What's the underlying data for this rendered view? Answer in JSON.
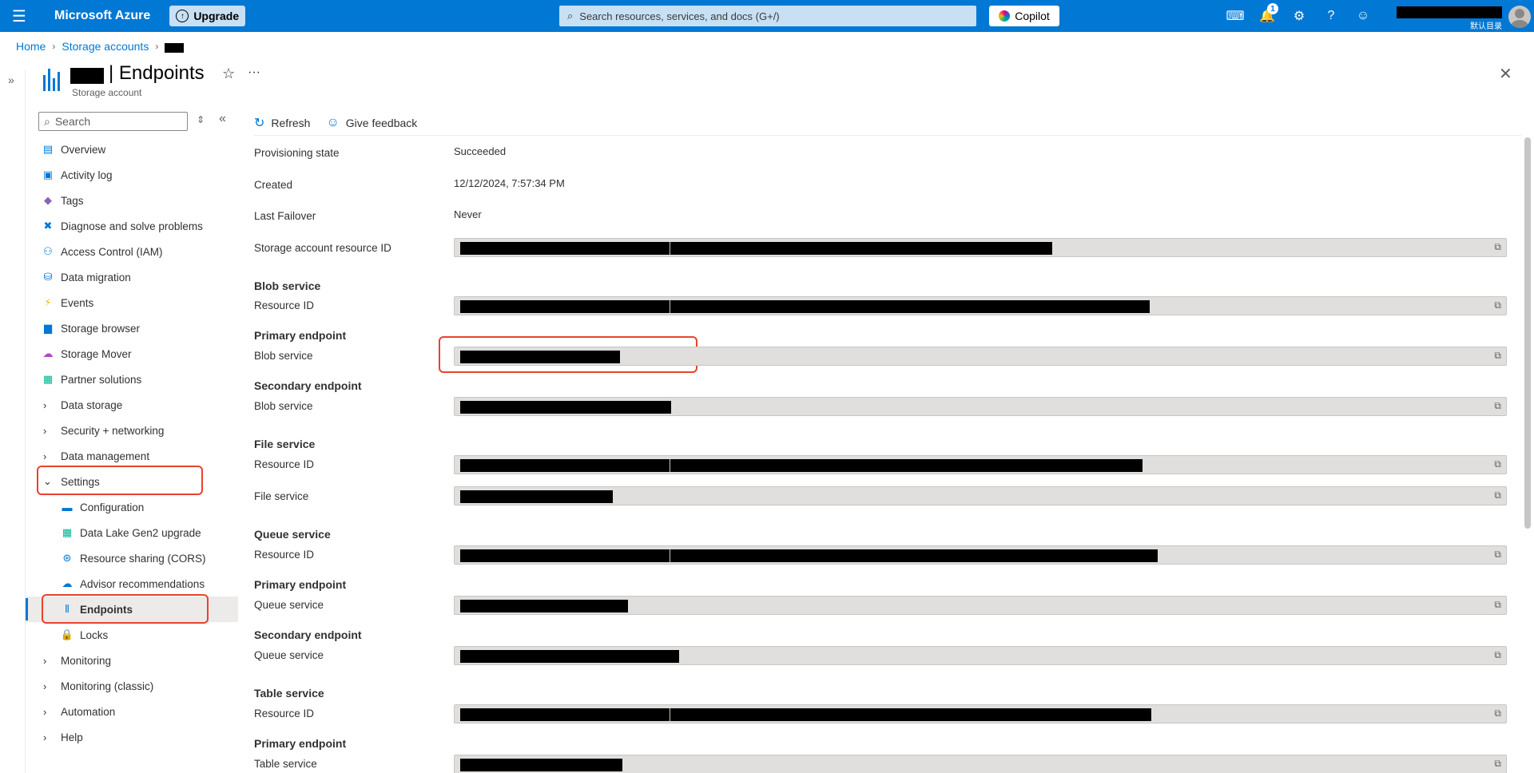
{
  "topbar": {
    "brand": "Microsoft Azure",
    "upgrade_label": "Upgrade",
    "search_placeholder": "Search resources, services, and docs (G+/)",
    "copilot_label": "Copilot",
    "notification_count": "1",
    "directory_label": "默认目录"
  },
  "breadcrumb": {
    "home": "Home",
    "storage_accounts": "Storage accounts"
  },
  "header": {
    "title": "| Endpoints",
    "subtitle": "Storage account"
  },
  "menu": {
    "search_placeholder": "Search",
    "items": [
      {
        "label": "Overview"
      },
      {
        "label": "Activity log"
      },
      {
        "label": "Tags"
      },
      {
        "label": "Diagnose and solve problems"
      },
      {
        "label": "Access Control (IAM)"
      },
      {
        "label": "Data migration"
      },
      {
        "label": "Events"
      },
      {
        "label": "Storage browser"
      },
      {
        "label": "Storage Mover"
      },
      {
        "label": "Partner solutions"
      },
      {
        "label": "Data storage"
      },
      {
        "label": "Security + networking"
      },
      {
        "label": "Data management"
      },
      {
        "label": "Settings"
      },
      {
        "label": "Configuration"
      },
      {
        "label": "Data Lake Gen2 upgrade"
      },
      {
        "label": "Resource sharing (CORS)"
      },
      {
        "label": "Advisor recommendations"
      },
      {
        "label": "Endpoints"
      },
      {
        "label": "Locks"
      },
      {
        "label": "Monitoring"
      },
      {
        "label": "Monitoring (classic)"
      },
      {
        "label": "Automation"
      },
      {
        "label": "Help"
      }
    ]
  },
  "toolbar": {
    "refresh": "Refresh",
    "feedback": "Give feedback"
  },
  "properties": {
    "provisioning_state_label": "Provisioning state",
    "provisioning_state_value": "Succeeded",
    "created_label": "Created",
    "created_value": "12/12/2024, 7:57:34 PM",
    "last_failover_label": "Last Failover",
    "last_failover_value": "Never",
    "storage_resource_id_label": "Storage account resource ID"
  },
  "sections": {
    "blob_service": "Blob service",
    "file_service": "File service",
    "queue_service": "Queue service",
    "table_service": "Table service",
    "primary_endpoint": "Primary endpoint",
    "secondary_endpoint": "Secondary endpoint",
    "resource_id": "Resource ID",
    "blob_service_field": "Blob service",
    "file_service_field": "File service",
    "queue_service_field": "Queue service",
    "table_service_field": "Table service"
  }
}
